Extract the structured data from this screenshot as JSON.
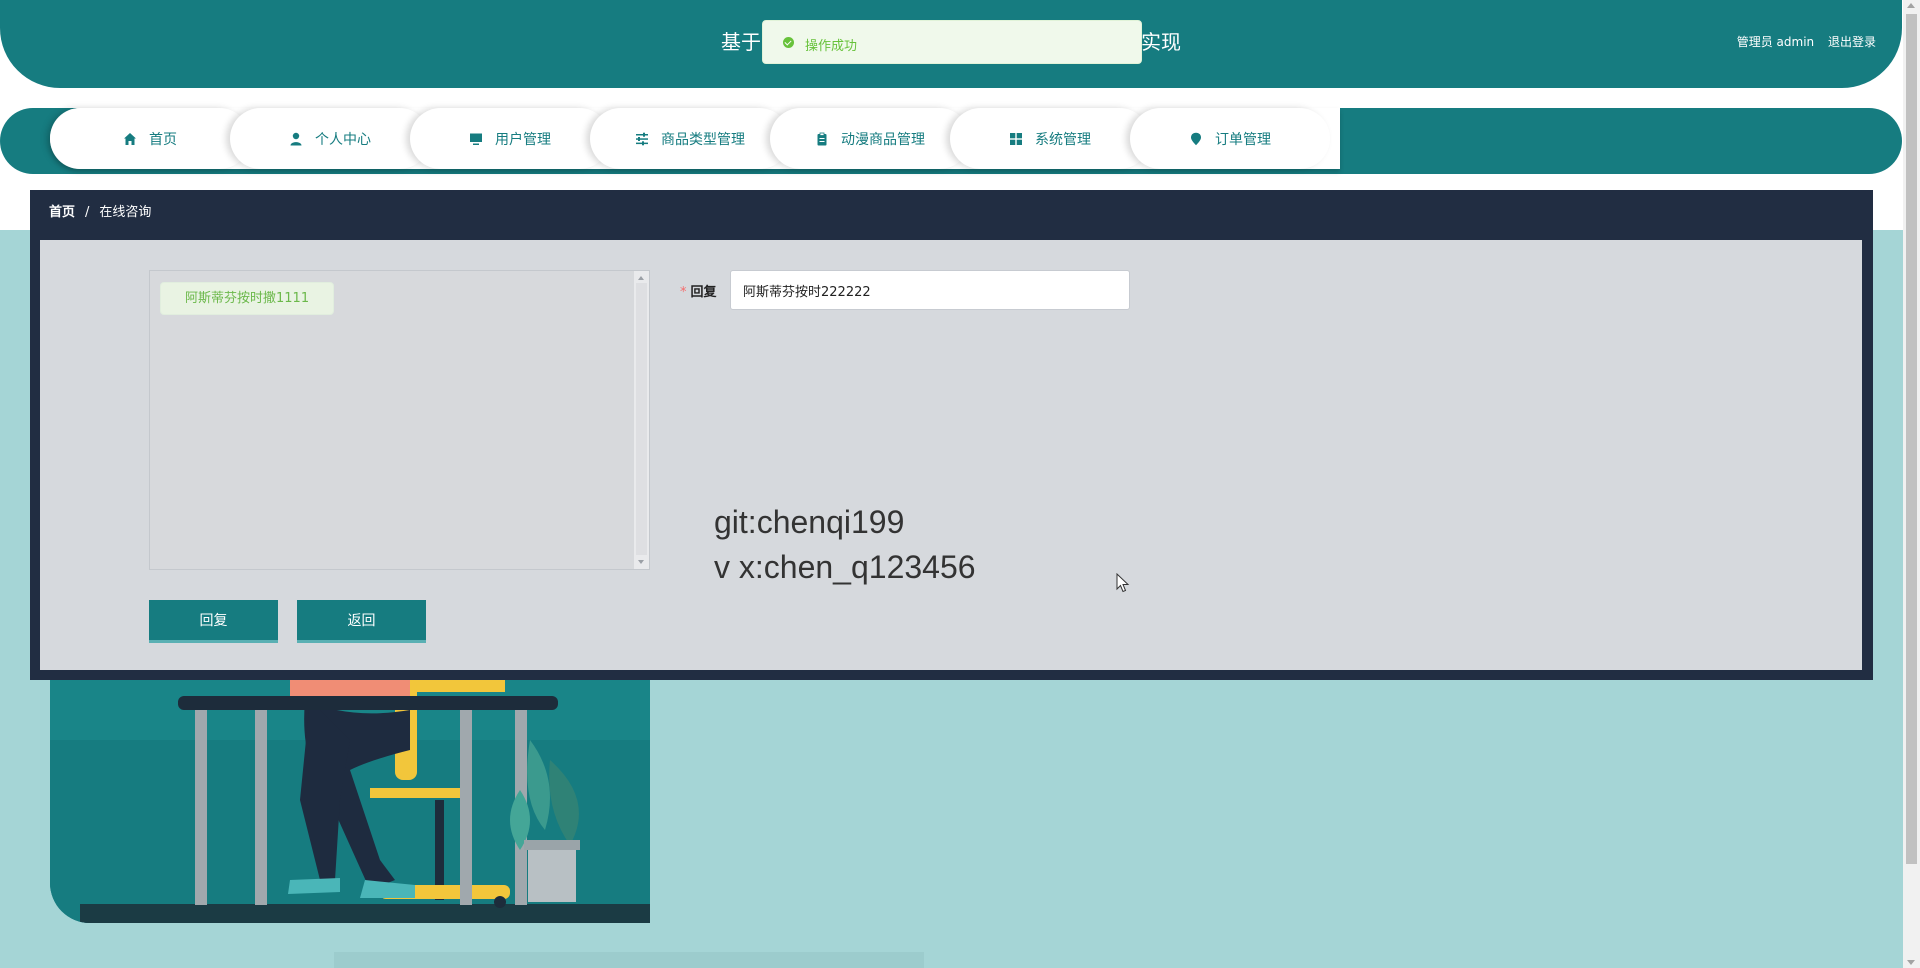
{
  "header": {
    "title_left": "基于",
    "title_right": "实现",
    "role": "管理员 admin",
    "logout": "退出登录"
  },
  "toast": {
    "message": "操作成功"
  },
  "nav": {
    "items": [
      {
        "label": "首页",
        "icon": "home-icon"
      },
      {
        "label": "个人中心",
        "icon": "user-icon"
      },
      {
        "label": "用户管理",
        "icon": "monitor-icon"
      },
      {
        "label": "商品类型管理",
        "icon": "sliders-icon"
      },
      {
        "label": "动漫商品管理",
        "icon": "clipboard-icon"
      },
      {
        "label": "系统管理",
        "icon": "grid-icon"
      },
      {
        "label": "订单管理",
        "icon": "pin-icon"
      }
    ]
  },
  "breadcrumb": {
    "home": "首页",
    "sep": "/",
    "current": "在线咨询"
  },
  "chat": {
    "message": "阿斯蒂芬按时撒1111"
  },
  "form": {
    "reply_label": "回复",
    "reply_value": "阿斯蒂芬按时222222"
  },
  "watermark": {
    "line1": "git:chenqi199",
    "line2": "v x:chen_q123456"
  },
  "buttons": {
    "reply": "回复",
    "back": "返回"
  },
  "colors": {
    "primary": "#167c80",
    "dark": "#212d42",
    "page_bg": "#a5d5d6",
    "success": "#67c23a"
  }
}
